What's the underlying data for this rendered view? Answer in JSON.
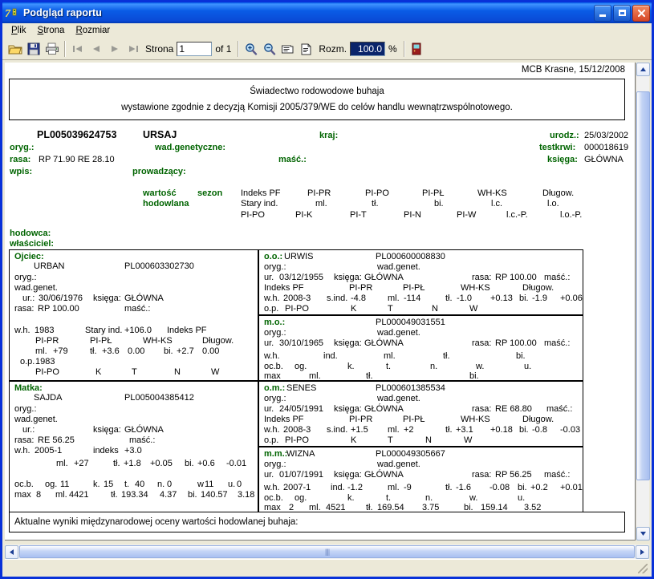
{
  "window": {
    "title": "Podgląd raportu",
    "icon": "report-preview-icon",
    "minimize": "_",
    "maximize": "□",
    "close": "✕"
  },
  "menu": {
    "items": [
      {
        "label": "Plik",
        "name": "menu-plik"
      },
      {
        "label": "Strona",
        "name": "menu-strona"
      },
      {
        "label": "Rozmiar",
        "name": "menu-rozmiar"
      }
    ]
  },
  "toolbar": {
    "open_icon": "open-folder-icon",
    "save_icon": "save-disk-icon",
    "print_icon": "print-icon",
    "first_icon": "first-page-icon",
    "prev_icon": "previous-page-icon",
    "next_icon": "next-page-icon",
    "last_icon": "last-page-icon",
    "page_label": "Strona",
    "page_value": "1",
    "page_of": "of 1",
    "zoom_in_icon": "zoom-in-icon",
    "zoom_out_icon": "zoom-out-icon",
    "fit_width_icon": "fit-width-icon",
    "fit_page_icon": "fit-page-icon",
    "zoom_label": "Rozm.",
    "zoom_value": "100.0",
    "percent": "%",
    "exit_icon": "exit-door-icon"
  },
  "report": {
    "header_right": "MCB Krasne, 15/12/2008",
    "title_line1": "Świadectwo  rodowodowe  buhaja",
    "title_line2": "wystawione zgodnie z decyzją Komisji 2005/379/WE do celów handlu wewnątrzwspólnotowego.",
    "animal": {
      "id": "PL005039624753",
      "name": "URSAJ",
      "lbl_oryg": "oryg.:",
      "val_oryg": "",
      "lbl_rasa": "rasa:",
      "val_rasa": "RP 71.90  RE 28.10",
      "lbl_wpis": "wpis:",
      "val_wpis": "",
      "lbl_wady": "wad.genetyczne:",
      "val_wady": "",
      "lbl_masc": "maść.:",
      "val_masc": "",
      "lbl_prowadzacy": "prowadzący:",
      "val_prowadzacy": "",
      "lbl_kraj": "kraj:",
      "val_kraj": "",
      "lbl_urodz": "urodz.:",
      "val_urodz": "25/03/2002",
      "lbl_testkrwi": "testkrwi:",
      "val_testkrwi": "000018619",
      "lbl_ksiega": "księga:",
      "val_ksiega": "GŁÓWNA"
    },
    "value_head": {
      "l1": "wartość",
      "l2": "hodowlana",
      "sezon": "sezon",
      "row1": [
        "Indeks PF",
        "PI-PR",
        "PI-PO",
        "PI-PŁ",
        "WH-KS",
        "Długow."
      ],
      "row2": [
        "Stary ind.",
        "ml.",
        "tł.",
        "bi.",
        "l.c.",
        "l.o."
      ],
      "row3": [
        "PI-PO",
        "PI-K",
        "PI-T",
        "PI-N",
        "PI-W",
        "l.c.-P.",
        "l.o.-P."
      ]
    },
    "lbl_hodowca": "hodowca:",
    "lbl_wlasciciel": "właściciel:",
    "ojciec": {
      "label": "Ojciec:",
      "name": "URBAN",
      "id": "PL000603302730",
      "lbl_oryg": "oryg.:",
      "lbl_wady": "wad.genet.",
      "lbl_ur": "ur.:",
      "val_ur": "30/06/1976",
      "lbl_ksiega": "księga:",
      "val_ksiega": "GŁÓWNA",
      "lbl_rasa": "rasa:",
      "val_rasa": "RP 100.00",
      "lbl_masc": "maść.:",
      "lbl_wh": "w.h.",
      "val_wh": "1983",
      "lbl_staryind": "Stary ind.",
      "val_staryind": "+106.0",
      "lbl_indekspf": "Indeks PF",
      "c_pipr": "PI-PR",
      "c_pipl": "PI-PŁ",
      "c_whks": "WH-KS",
      "c_dlugow": "Długow.",
      "lbl_ml": "ml.",
      "val_ml": "+79",
      "lbl_tl": "tł.",
      "val_tl": "+3.6",
      "val_tl2": "0.00",
      "lbl_bi": "bi.",
      "val_bi": "+2.7",
      "val_bi2": "0.00",
      "lbl_op": "o.p.",
      "val_op": "1983",
      "c_pipo": "PI-PO",
      "c_k": "K",
      "c_t": "T",
      "c_n": "N",
      "c_w": "W"
    },
    "matka": {
      "label": "Matka:",
      "name": "SAJDA",
      "id": "PL005004385412",
      "lbl_oryg": "oryg.:",
      "lbl_wady": "wad.genet.",
      "lbl_ur": "ur.:",
      "val_ur": "",
      "lbl_ksiega": "księga:",
      "val_ksiega": "GŁÓWNA",
      "lbl_rasa": "rasa:",
      "val_rasa": "RE 56.25",
      "lbl_masc": "maść.:",
      "lbl_wh": "w.h.",
      "val_wh": "2005-1",
      "lbl_indeks": "indeks",
      "val_indeks": "+3.0",
      "lbl_ml": "ml.",
      "val_ml": "+27",
      "lbl_tl": "tł.",
      "val_tl": "+1.8",
      "val_tl2": "+0.05",
      "lbl_bi": "bi.",
      "val_bi": "+0.6",
      "val_bi2": "-0.01",
      "lbl_ocb": "oc.b.",
      "lbl_og": "og.",
      "val_og": "11",
      "lbl_k": "k.",
      "val_k": "15",
      "lbl_t": "t.",
      "val_t": "40",
      "lbl_n": "n.",
      "val_n": "0",
      "lbl_w": "w",
      "val_w": "11",
      "lbl_u": "u.",
      "val_u": "0",
      "lbl_max": "max",
      "val_max": "8",
      "m_ml": "ml.",
      "m_ml_v": "4421",
      "m_tl": "tł.",
      "m_tl_v": "193.34",
      "m_tl_v2": "4.37",
      "m_bi": "bi.",
      "m_bi_v": "140.57",
      "m_bi_v2": "3.18"
    },
    "oo": {
      "label": "o.o.:",
      "name": "URWIS",
      "id": "PL000600008830",
      "lbl_oryg": "oryg.:",
      "lbl_wady": "wad.genet.",
      "lbl_ur": "ur.",
      "val_ur": "03/12/1955",
      "lbl_ksiega": "księga:",
      "val_ksiega": "GŁÓWNA",
      "lbl_rasa": "rasa:",
      "val_rasa": "RP 100.00",
      "lbl_masc": "maść.:",
      "c1": "Indeks PF",
      "c2": "PI-PR",
      "c3": "PI-PŁ",
      "c4": "WH-KS",
      "c5": "Długow.",
      "lbl_wh": "w.h.",
      "val_wh": "2008-3",
      "lbl_sind": "s.ind.",
      "val_sind": "-4.8",
      "lbl_ml": "ml.",
      "val_ml": "-114",
      "lbl_tl": "tł.",
      "val_tl": "-1.0",
      "val_tl2": "+0.13",
      "lbl_bi": "bi.",
      "val_bi": "-1.9",
      "val_bi2": "+0.06",
      "lbl_op": "o.p.",
      "c_pipo": "PI-PO",
      "c_k": "K",
      "c_t": "T",
      "c_n": "N",
      "c_w": "W"
    },
    "mo": {
      "label": "m.o.:",
      "name": "",
      "id": "PL000049031551",
      "lbl_oryg": "oryg.:",
      "lbl_wady": "wad.genet.",
      "lbl_ur": "ur.",
      "val_ur": "30/10/1965",
      "lbl_ksiega": "księga:",
      "val_ksiega": "GŁÓWNA",
      "lbl_rasa": "rasa:",
      "val_rasa": "RP 100.00",
      "lbl_masc": "maść.:",
      "lbl_wh": "w.h.",
      "lbl_ind": "ind.",
      "lbl_ml": "ml.",
      "lbl_tl": "tł.",
      "lbl_bi": "bi.",
      "lbl_ocb": "oc.b.",
      "lbl_og": "og.",
      "lbl_k": "k.",
      "lbl_t": "t.",
      "lbl_n": "n.",
      "lbl_w": "w.",
      "lbl_u": "u.",
      "lbl_max": "max",
      "m_ml": "ml.",
      "m_tl": "tł.",
      "m_bi": "bi."
    },
    "om": {
      "label": "o.m.:",
      "name": "SENES",
      "id": "PL000601385534",
      "lbl_oryg": "oryg.:",
      "lbl_wady": "wad.genet.",
      "lbl_ur": "ur.",
      "val_ur": "24/05/1991",
      "lbl_ksiega": "księga:",
      "val_ksiega": "GŁÓWNA",
      "lbl_rasa": "rasa:",
      "val_rasa": "RE 68.80",
      "lbl_masc": "maść.:",
      "c1": "Indeks PF",
      "c2": "PI-PR",
      "c3": "PI-PŁ",
      "c4": "WH-KS",
      "c5": "Długow.",
      "lbl_wh": "w.h.",
      "val_wh": "2008-3",
      "lbl_sind": "s.ind.",
      "val_sind": "+1.5",
      "lbl_ml": "ml.",
      "val_ml": "+2",
      "lbl_tl": "tł.",
      "val_tl": "+3.1",
      "val_tl2": "+0.18",
      "lbl_bi": "bi.",
      "val_bi": "-0.8",
      "val_bi2": "-0.03",
      "lbl_op": "o.p.",
      "c_pipo": "PI-PO",
      "c_k": "K",
      "c_t": "T",
      "c_n": "N",
      "c_w": "W"
    },
    "mm": {
      "label": "m.m.:",
      "name": "WIZNA",
      "id": "PL000049305667",
      "lbl_oryg": "oryg.:",
      "lbl_wady": "wad.genet.",
      "lbl_ur": "ur.",
      "val_ur": "01/07/1991",
      "lbl_ksiega": "księga:",
      "val_ksiega": "GŁÓWNA",
      "lbl_rasa": "rasa:",
      "val_rasa": "RP 56.25",
      "lbl_masc": "maść.:",
      "lbl_wh": "w.h.",
      "val_wh": "2007-1",
      "lbl_ind": "ind.",
      "val_ind": "-1.2",
      "lbl_ml": "ml.",
      "val_ml": "-9",
      "lbl_tl": "tł.",
      "val_tl": "-1.6",
      "val_tl2": "-0.08",
      "lbl_bi": "bi.",
      "val_bi": "+0.2",
      "val_bi2": "+0.01",
      "lbl_ocb": "oc.b.",
      "lbl_og": "og.",
      "lbl_k": "k.",
      "lbl_t": "t.",
      "lbl_n": "n.",
      "lbl_w": "w.",
      "lbl_u": "u.",
      "lbl_max": "max",
      "val_max": "2",
      "m_ml": "ml.",
      "m_ml_v": "4521",
      "m_tl": "tł.",
      "m_tl_v": "169.54",
      "m_tl_v2": "3.75",
      "m_bi": "bi.",
      "m_bi_v": "159.14",
      "m_bi_v2": "3.52"
    },
    "footer_note": "Aktualne wyniki międzynarodowej oceny wartości hodowlanej buhaja:"
  },
  "scroll": {
    "up_arrow": "▲",
    "down_arrow": "▼",
    "left_arrow": "❮",
    "right_arrow": "❯",
    "grip": "||||"
  },
  "colors": {
    "label_green": "#006400",
    "title_blue": "#0a4ad6",
    "selection": "#0a246a"
  }
}
